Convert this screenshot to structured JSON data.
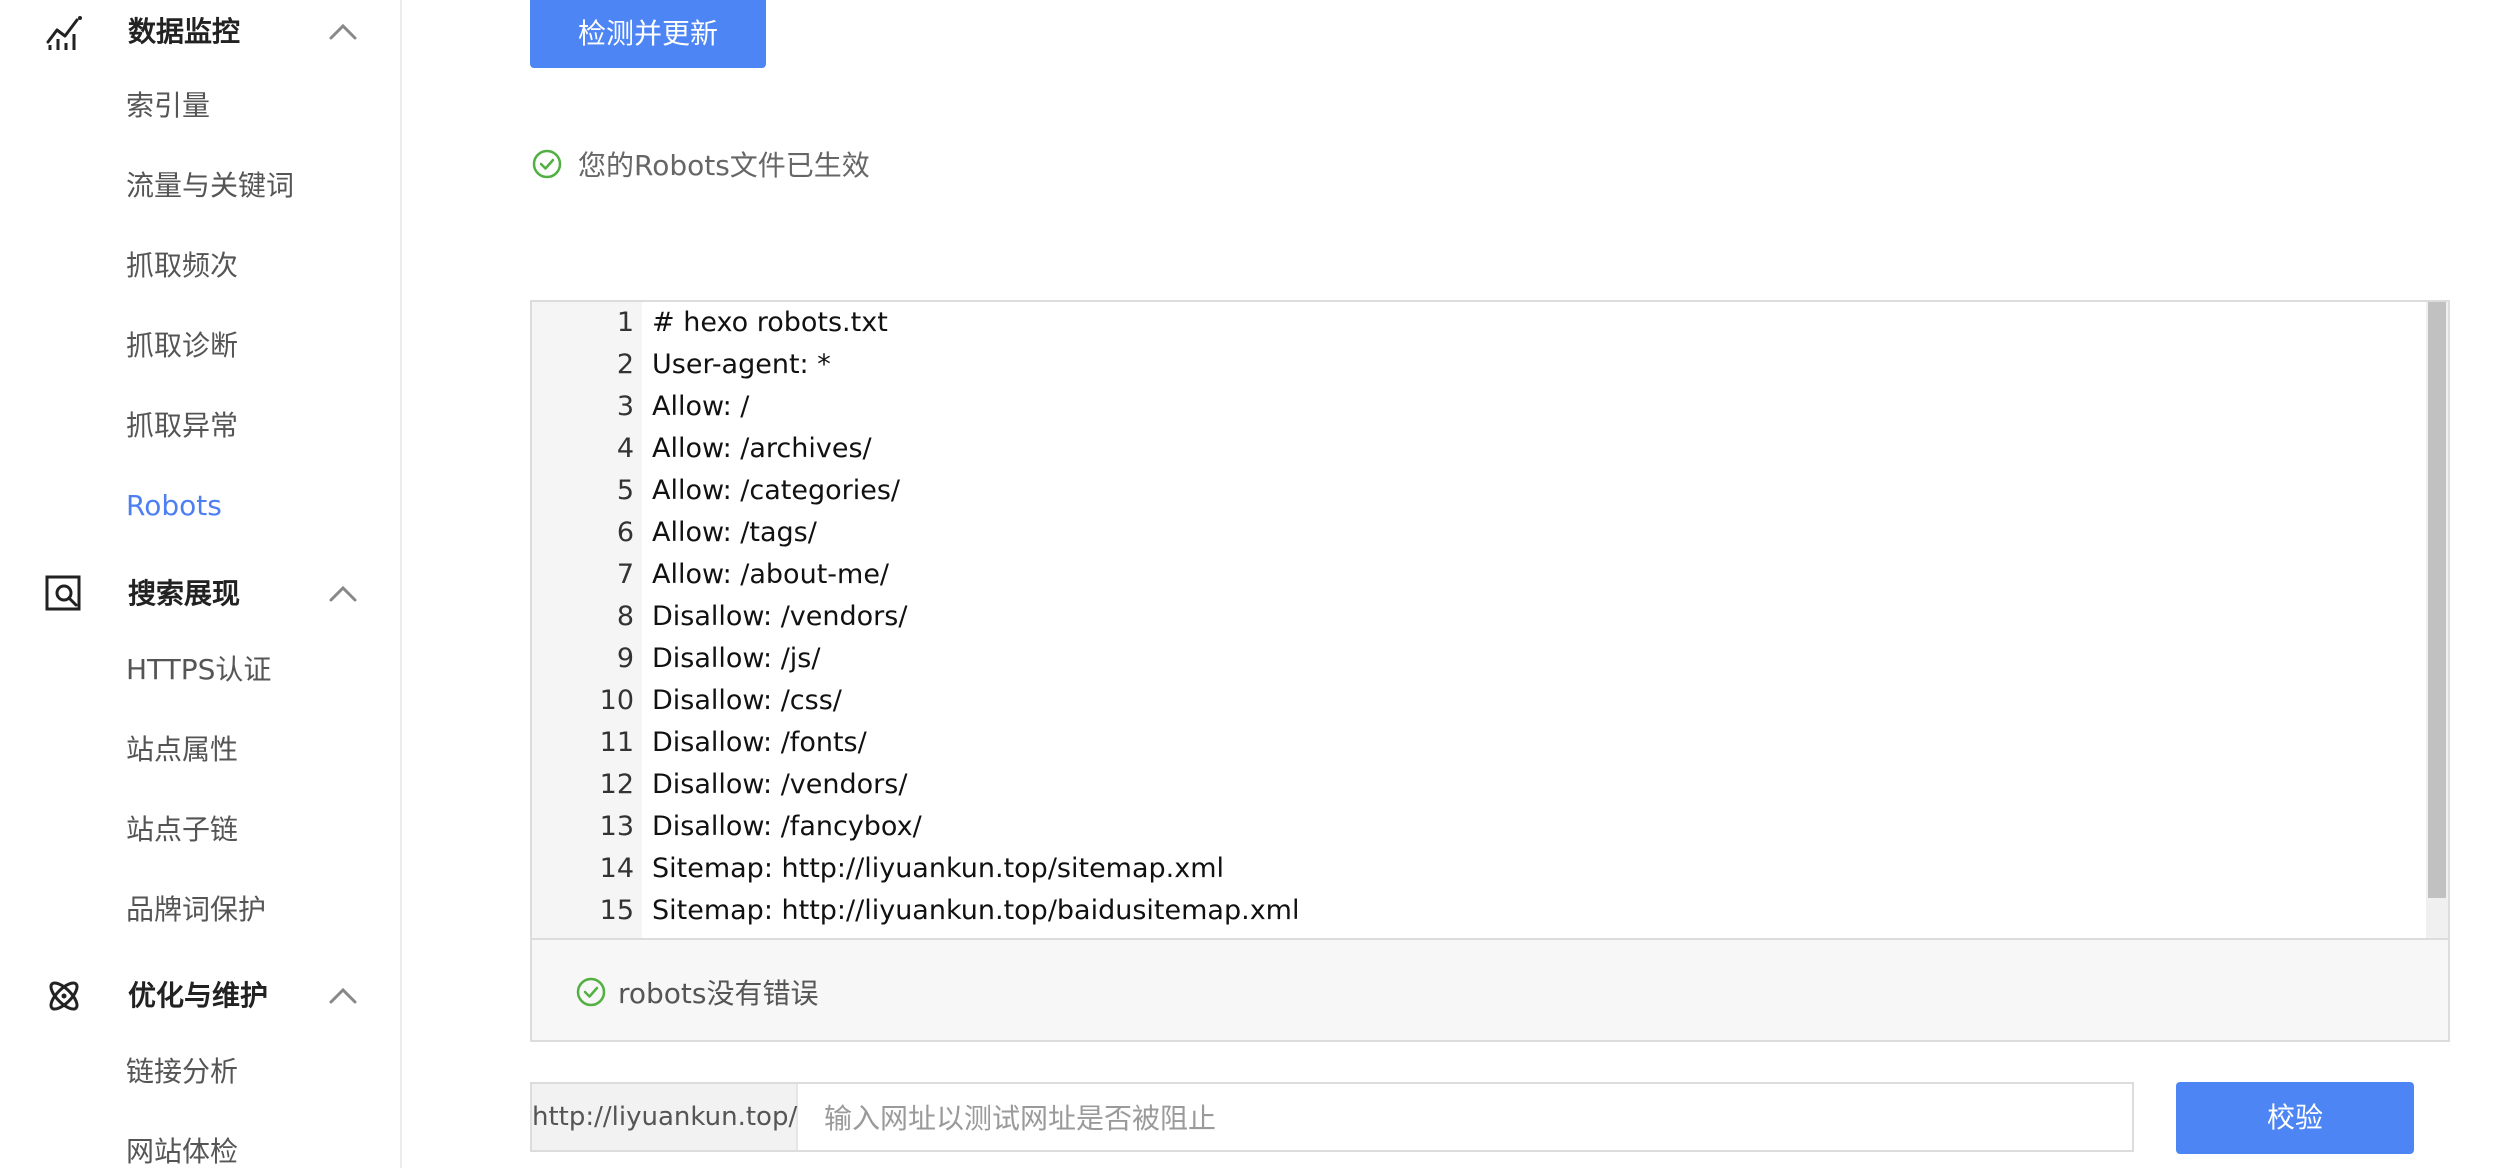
{
  "sidebar": {
    "groups": [
      {
        "title": "数据监控",
        "icon": "chart-line-icon",
        "items": [
          "索引量",
          "流量与关键词",
          "抓取频次",
          "抓取诊断",
          "抓取异常",
          "Robots"
        ]
      },
      {
        "title": "搜索展现",
        "icon": "search-display-icon",
        "items": [
          "HTTPS认证",
          "站点属性",
          "站点子链",
          "品牌词保护"
        ]
      },
      {
        "title": "优化与维护",
        "icon": "atom-icon",
        "items": [
          "链接分析",
          "网站体检"
        ]
      }
    ],
    "active_item": "Robots"
  },
  "main": {
    "detect_button": "检测并更新",
    "status_text": "您的Robots文件已生效",
    "editor_lines": [
      {
        "n": "1",
        "text": "# hexo robots.txt"
      },
      {
        "n": "2",
        "text": "User-agent: *"
      },
      {
        "n": "3",
        "text": "Allow: /"
      },
      {
        "n": "4",
        "text": "Allow: /archives/"
      },
      {
        "n": "5",
        "text": "Allow: /categories/"
      },
      {
        "n": "6",
        "text": "Allow: /tags/"
      },
      {
        "n": "7",
        "text": "Allow: /about-me/"
      },
      {
        "n": "8",
        "text": "Disallow: /vendors/"
      },
      {
        "n": "9",
        "text": "Disallow: /js/"
      },
      {
        "n": "10",
        "text": "Disallow: /css/"
      },
      {
        "n": "11",
        "text": "Disallow: /fonts/"
      },
      {
        "n": "12",
        "text": "Disallow: /vendors/"
      },
      {
        "n": "13",
        "text": "Disallow: /fancybox/"
      },
      {
        "n": "14",
        "text": "Sitemap: http://liyuankun.top/sitemap.xml"
      },
      {
        "n": "15",
        "text": "Sitemap: http://liyuankun.top/baidusitemap.xml"
      }
    ],
    "result_text": "robots没有错误",
    "url_prefix": "http://liyuankun.top/",
    "url_placeholder": "输入网址以测试网址是否被阻止",
    "verify_button": "校验"
  },
  "colors": {
    "accent": "#4e85f4",
    "active_nav": "#4e7ff2",
    "success": "#52b043"
  }
}
